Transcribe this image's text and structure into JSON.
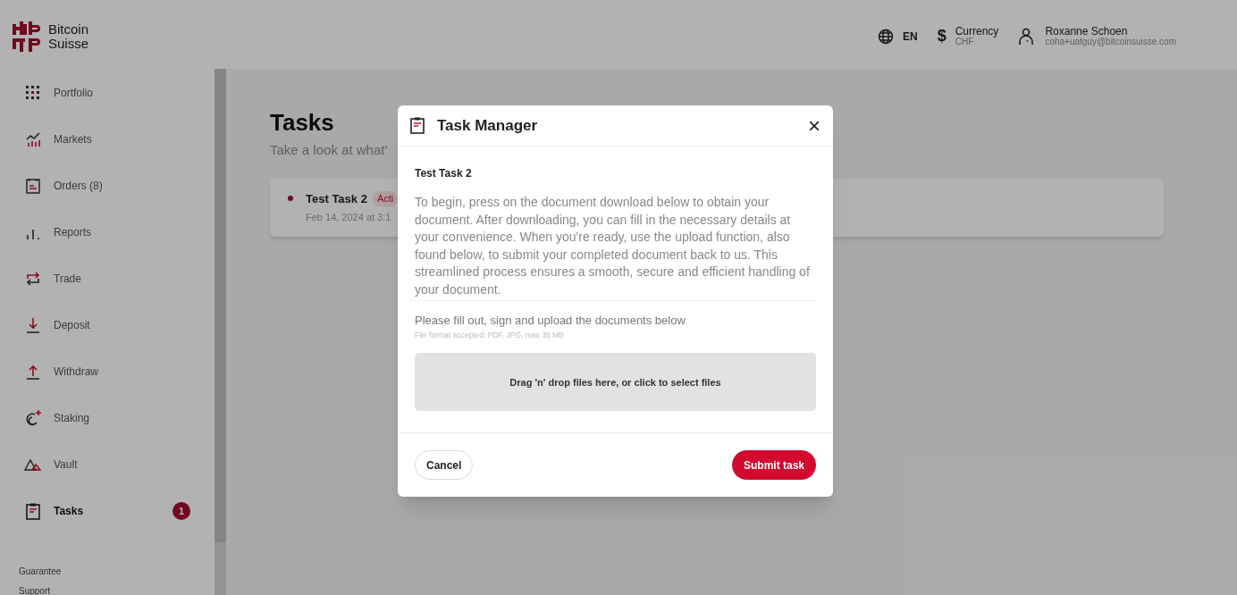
{
  "brand": {
    "line_1": "Bitcoin",
    "line_2": "Suisse"
  },
  "header": {
    "language": "EN",
    "currency_icon": "$",
    "currency_label": "Currency",
    "currency_value": "CHF",
    "user_name": "Roxanne Schoen",
    "user_email": "coha+uatguy@bitcoinsuisse.com"
  },
  "sidebar": {
    "items": [
      {
        "kind": "grid",
        "label": "Portfolio",
        "selected": false
      },
      {
        "kind": "chart",
        "label": "Markets",
        "selected": false
      },
      {
        "kind": "orders",
        "label": "Orders (8)",
        "selected": false
      },
      {
        "kind": "bars",
        "label": "Reports",
        "selected": false
      },
      {
        "kind": "trade",
        "label": "Trade",
        "selected": false
      },
      {
        "kind": "down",
        "label": "Deposit",
        "selected": false
      },
      {
        "kind": "up",
        "label": "Withdraw",
        "selected": false
      },
      {
        "kind": "staking",
        "label": "Staking",
        "selected": false
      },
      {
        "kind": "vault",
        "label": "Vault",
        "selected": false
      },
      {
        "kind": "tasks",
        "label": "Tasks",
        "selected": true,
        "badge": "1"
      }
    ],
    "footer_links": [
      "Guarantee",
      "Support"
    ]
  },
  "page": {
    "title": "Tasks",
    "subtitle": "Take a look at what'",
    "tasks": [
      {
        "title": "Test Task 2",
        "status": "Acti",
        "date": "Feb 14, 2024 at 3:1"
      }
    ]
  },
  "modal": {
    "title": "Task Manager",
    "close": "×",
    "task_title": "Test Task 2",
    "description": "To begin, press on the document download below to obtain your document. After downloading, you can fill in the necessary details at your convenience. When you're ready, use the upload function, also found below, to submit your completed document back to us. This streamlined process ensures a smooth, secure and efficient handling of your document.",
    "upload_heading": "Please fill out, sign and upload the documents below",
    "upload_hint": "File format accepted: PDF, JPG, max 35 MB",
    "dropzone": "Drag 'n' drop files here, or click to select files",
    "buttons": [
      "Cancel",
      "Submit task"
    ]
  }
}
